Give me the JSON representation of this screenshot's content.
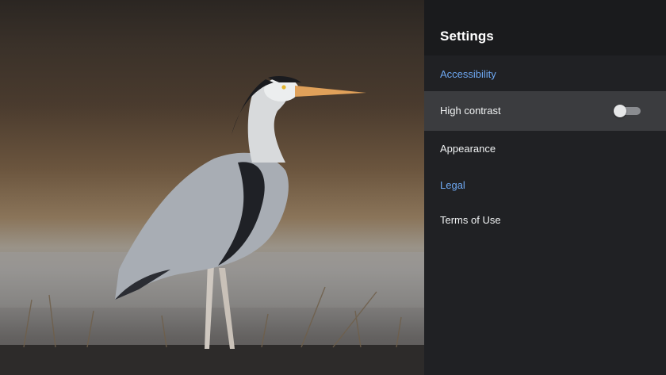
{
  "settings": {
    "title": "Settings",
    "accessibility_header": "Accessibility",
    "high_contrast": {
      "label": "High contrast",
      "enabled": false
    },
    "appearance_label": "Appearance",
    "legal_header": "Legal",
    "terms_label": "Terms of Use"
  },
  "colors": {
    "accent": "#6ea8f2",
    "panel_bg": "#202124",
    "header_bg": "#1a1b1d",
    "focused_row_bg": "#3b3c3f"
  }
}
